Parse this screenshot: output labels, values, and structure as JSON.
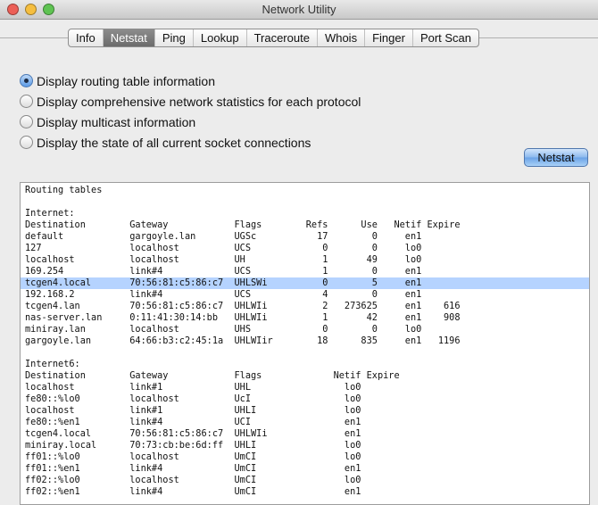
{
  "window": {
    "title": "Network Utility"
  },
  "tabs": [
    "Info",
    "Netstat",
    "Ping",
    "Lookup",
    "Traceroute",
    "Whois",
    "Finger",
    "Port Scan"
  ],
  "active_tab": "Netstat",
  "options": [
    {
      "label": "Display routing table information",
      "selected": true
    },
    {
      "label": "Display comprehensive network statistics for each protocol",
      "selected": false
    },
    {
      "label": "Display multicast information",
      "selected": false
    },
    {
      "label": "Display the state of all current socket connections",
      "selected": false
    }
  ],
  "run_button": "Netstat",
  "output": {
    "heading": "Routing tables",
    "internet": {
      "title": "Internet:",
      "columns": [
        "Destination",
        "Gateway",
        "Flags",
        "Refs",
        "Use",
        "Netif",
        "Expire"
      ],
      "rows": [
        [
          "default",
          "gargoyle.lan",
          "UGSc",
          "17",
          "0",
          "en1",
          ""
        ],
        [
          "127",
          "localhost",
          "UCS",
          "0",
          "0",
          "lo0",
          ""
        ],
        [
          "localhost",
          "localhost",
          "UH",
          "1",
          "49",
          "lo0",
          ""
        ],
        [
          "169.254",
          "link#4",
          "UCS",
          "1",
          "0",
          "en1",
          ""
        ],
        [
          "tcgen4.local",
          "70:56:81:c5:86:c7",
          "UHLSWi",
          "0",
          "5",
          "en1",
          ""
        ],
        [
          "192.168.2",
          "link#4",
          "UCS",
          "4",
          "0",
          "en1",
          ""
        ],
        [
          "tcgen4.lan",
          "70:56:81:c5:86:c7",
          "UHLWIi",
          "2",
          "273625",
          "en1",
          "616"
        ],
        [
          "nas-server.lan",
          "0:11:41:30:14:bb",
          "UHLWIi",
          "1",
          "42",
          "en1",
          "908"
        ],
        [
          "miniray.lan",
          "localhost",
          "UHS",
          "0",
          "0",
          "lo0",
          ""
        ],
        [
          "gargoyle.lan",
          "64:66:b3:c2:45:1a",
          "UHLWIir",
          "18",
          "835",
          "en1",
          "1196"
        ]
      ],
      "selected_row": 4
    },
    "internet6": {
      "title": "Internet6:",
      "columns": [
        "Destination",
        "Gateway",
        "Flags",
        "Netif",
        "Expire"
      ],
      "rows": [
        [
          "localhost",
          "link#1",
          "UHL",
          "lo0",
          ""
        ],
        [
          "fe80::%lo0",
          "localhost",
          "UcI",
          "lo0",
          ""
        ],
        [
          "localhost",
          "link#1",
          "UHLI",
          "lo0",
          ""
        ],
        [
          "fe80::%en1",
          "link#4",
          "UCI",
          "en1",
          ""
        ],
        [
          "tcgen4.local",
          "70:56:81:c5:86:c7",
          "UHLWIi",
          "en1",
          ""
        ],
        [
          "miniray.local",
          "70:73:cb:be:6d:ff",
          "UHLI",
          "lo0",
          ""
        ],
        [
          "ff01::%lo0",
          "localhost",
          "UmCI",
          "lo0",
          ""
        ],
        [
          "ff01::%en1",
          "link#4",
          "UmCI",
          "en1",
          ""
        ],
        [
          "ff02::%lo0",
          "localhost",
          "UmCI",
          "lo0",
          ""
        ],
        [
          "ff02::%en1",
          "link#4",
          "UmCI",
          "en1",
          ""
        ]
      ]
    }
  }
}
